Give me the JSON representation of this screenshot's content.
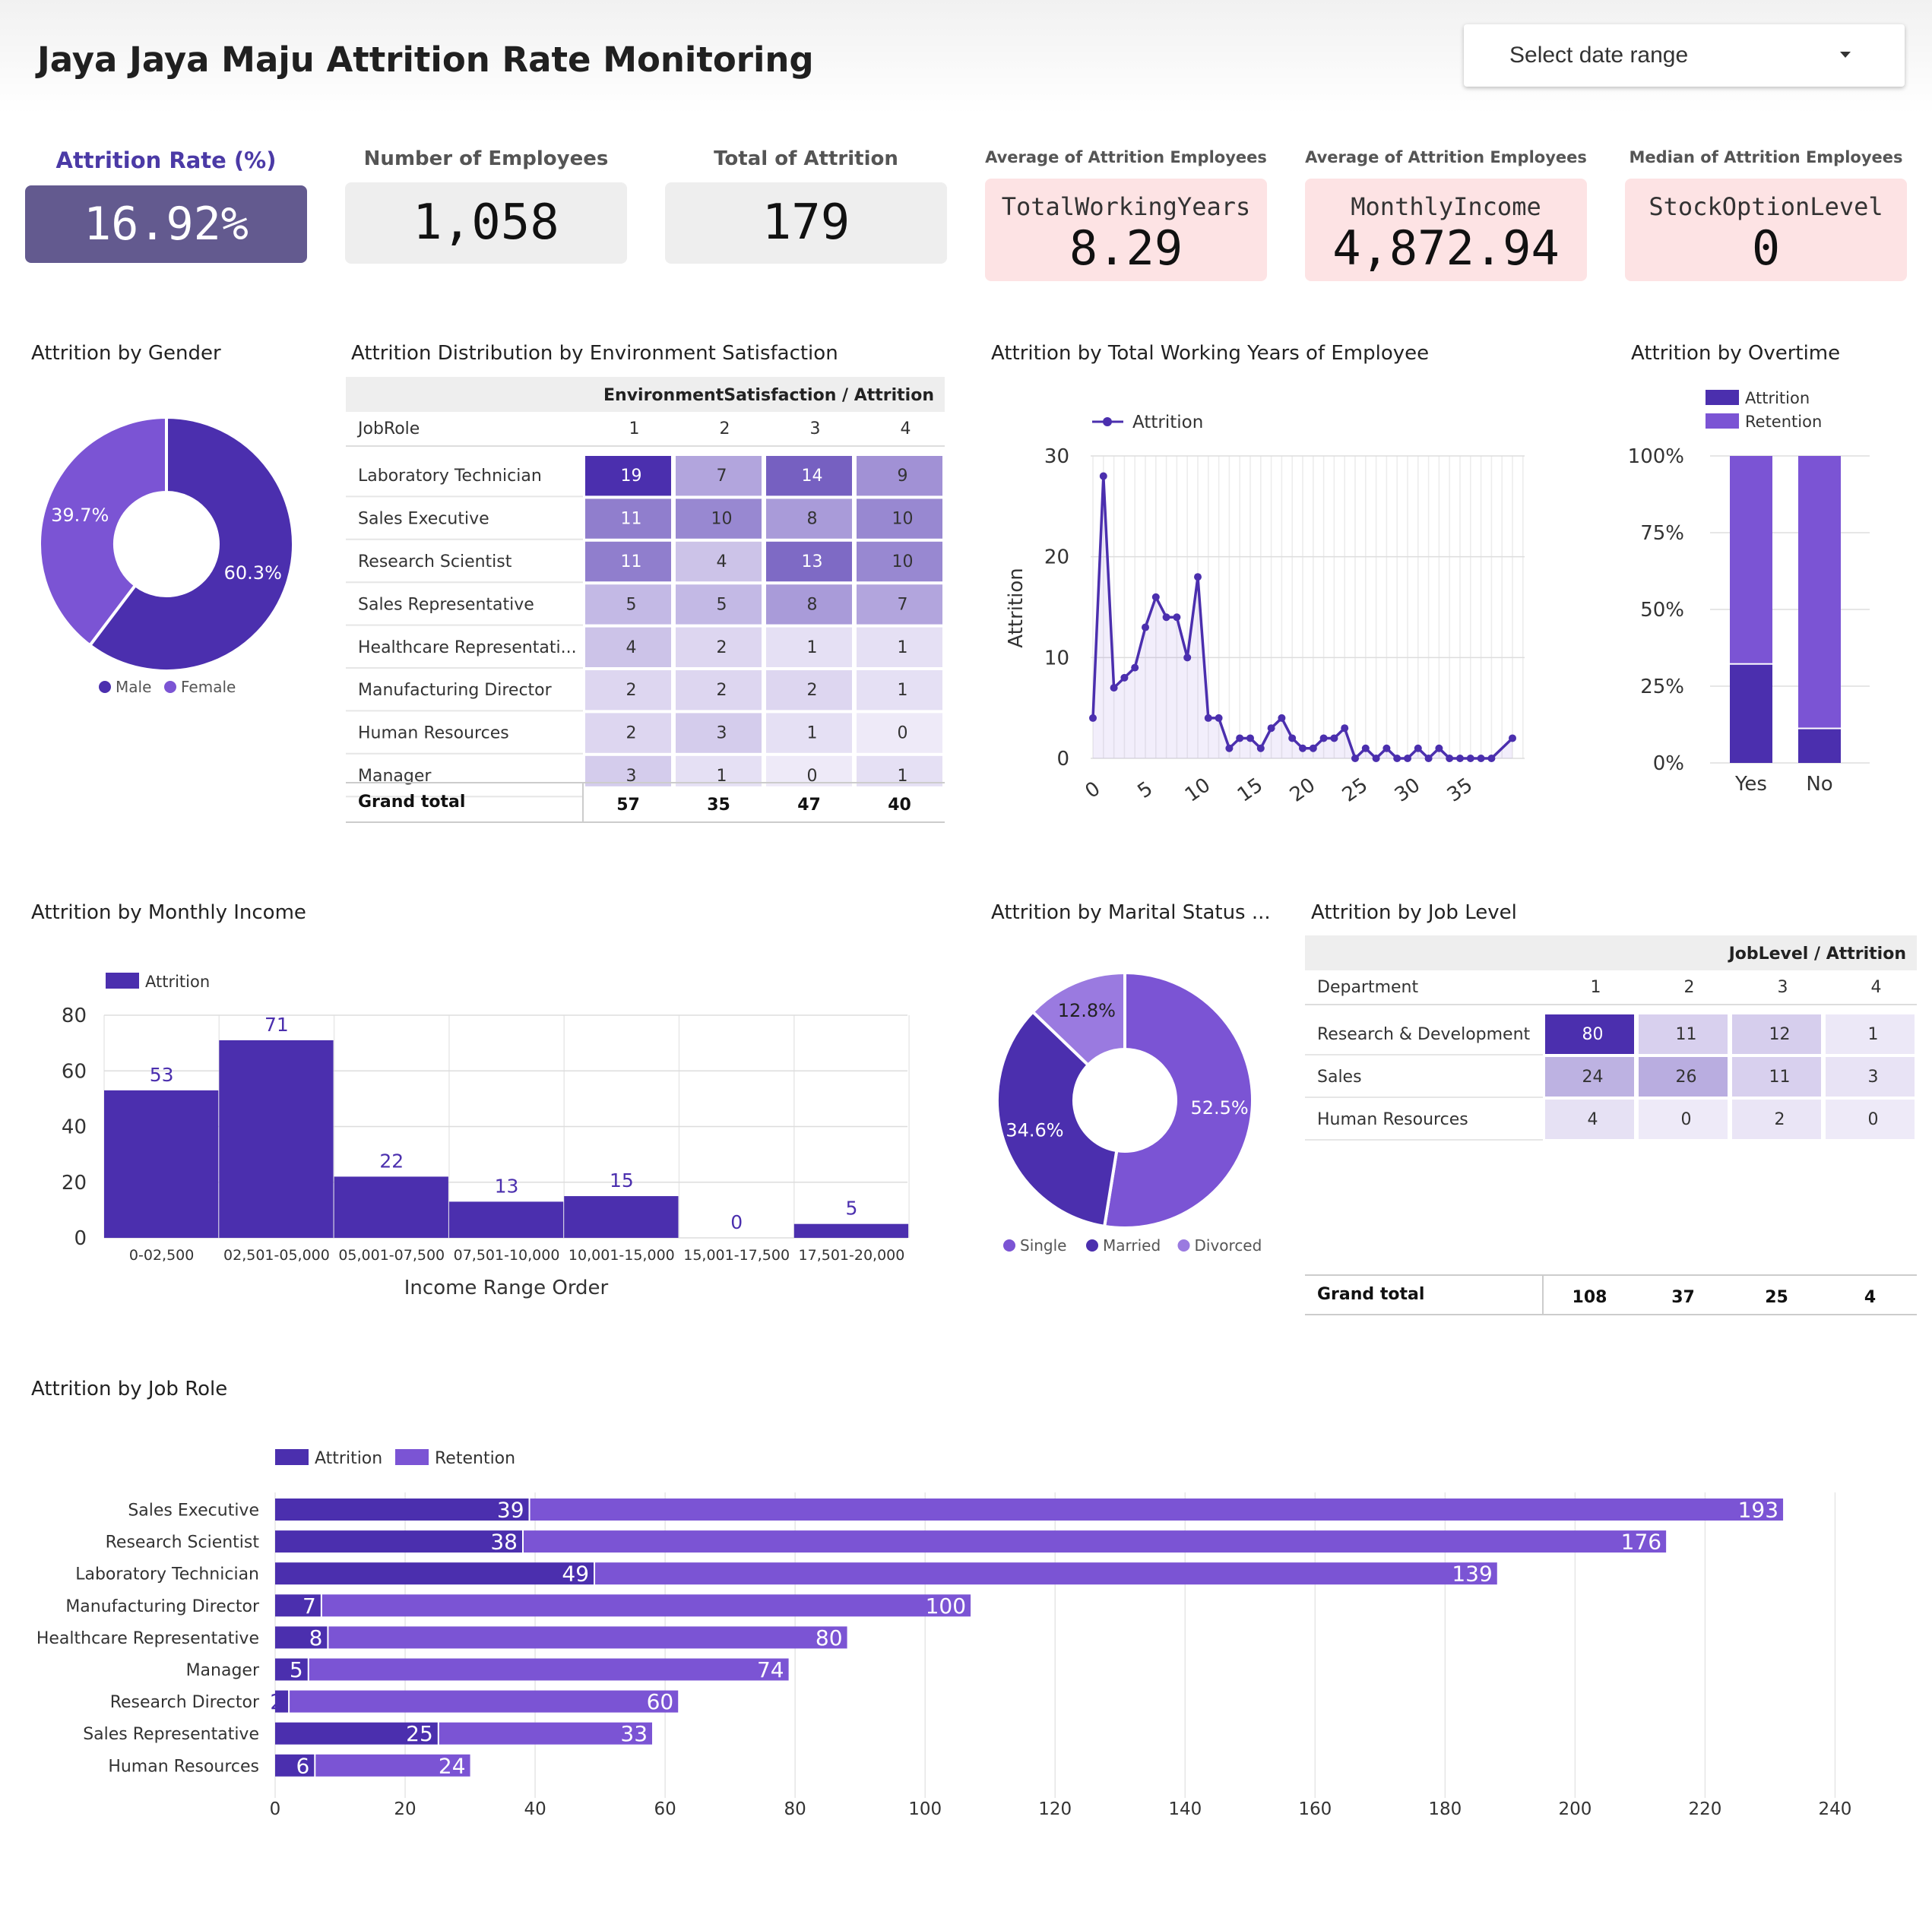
{
  "header": {
    "title": "Jaya Jaya Maju Attrition Rate Monitoring",
    "date_range_label": "Select date range"
  },
  "kpis": [
    {
      "label": "Attrition Rate (%)",
      "value": "16.92%"
    },
    {
      "label": "Number of Employees",
      "value": "1,058"
    },
    {
      "label": "Total of Attrition",
      "value": "179"
    },
    {
      "label": "Average of Attrition Employees",
      "metric": "TotalWorkingYears",
      "value": "8.29"
    },
    {
      "label": "Average of Attrition Employees",
      "metric": "MonthlyIncome",
      "value": "4,872.94"
    },
    {
      "label": "Median of Attrition Employees",
      "metric": "StockOptionLevel",
      "value": "0"
    }
  ],
  "colors": {
    "dark_purple": "#4b2fae",
    "mid_purple": "#7b54d4",
    "light_purple": "#9a7ae0",
    "kpi_primary": "#635a8f",
    "kpi_grey": "#eeeeee",
    "kpi_pink": "#fde3e4"
  },
  "sections": {
    "gender": "Attrition by Gender",
    "env": "Attrition Distribution by Environment Satisfaction",
    "years": "Attrition by Total Working Years of Employee",
    "overtime": "Attrition by Overtime",
    "income": "Attrition by Monthly Income",
    "marital": "Attrition by Marital Status ...",
    "joblevel": "Attrition by Job Level",
    "jobrole": "Attrition by Job Role"
  },
  "chart_data": [
    {
      "id": "gender",
      "type": "pie",
      "donut": true,
      "labels": [
        "Male",
        "Female"
      ],
      "values": [
        60.3,
        39.7
      ],
      "value_labels": [
        "60.3%",
        "39.7%"
      ],
      "legend": "bottom"
    },
    {
      "id": "env",
      "type": "table",
      "pivot_header": "EnvironmentSatisfaction / Attrition",
      "row_header": "JobRole",
      "columns": [
        "1",
        "2",
        "3",
        "4"
      ],
      "rows": [
        {
          "label": "Laboratory Technician",
          "values": [
            19,
            7,
            14,
            9
          ]
        },
        {
          "label": "Sales Executive",
          "values": [
            11,
            10,
            8,
            10
          ]
        },
        {
          "label": "Research Scientist",
          "values": [
            11,
            4,
            13,
            10
          ]
        },
        {
          "label": "Sales Representative",
          "values": [
            5,
            5,
            8,
            7
          ]
        },
        {
          "label": "Healthcare Representati...",
          "values": [
            4,
            2,
            1,
            1
          ]
        },
        {
          "label": "Manufacturing Director",
          "values": [
            2,
            2,
            2,
            1
          ]
        },
        {
          "label": "Human Resources",
          "values": [
            2,
            3,
            1,
            0
          ]
        },
        {
          "label": "Manager",
          "values": [
            3,
            1,
            0,
            1
          ]
        }
      ],
      "total_label": "Grand total",
      "totals": [
        57,
        35,
        47,
        40
      ]
    },
    {
      "id": "years",
      "type": "line",
      "series_name": "Attrition",
      "xlabel": "",
      "ylabel": "Attrition",
      "x": [
        0,
        1,
        2,
        3,
        4,
        5,
        6,
        7,
        8,
        9,
        10,
        11,
        12,
        13,
        14,
        15,
        16,
        17,
        18,
        19,
        20,
        21,
        22,
        23,
        24,
        25,
        26,
        27,
        28,
        29,
        30,
        31,
        32,
        33,
        34,
        35,
        36,
        37,
        38,
        40
      ],
      "y": [
        4,
        28,
        7,
        8,
        9,
        13,
        16,
        14,
        14,
        10,
        18,
        4,
        4,
        1,
        2,
        2,
        1,
        3,
        4,
        2,
        1,
        1,
        2,
        2,
        3,
        0,
        1,
        0,
        1,
        0,
        0,
        1,
        0,
        1,
        0,
        0,
        0,
        0,
        0,
        2
      ],
      "xticks": [
        "0",
        "5",
        "10",
        "15",
        "20",
        "25",
        "30",
        "35"
      ],
      "yticks": [
        "0",
        "10",
        "20",
        "30"
      ],
      "ylim": [
        0,
        30
      ],
      "legend": "top-left",
      "grid": true
    },
    {
      "id": "overtime",
      "type": "bar",
      "stacked_percent": true,
      "categories": [
        "Yes",
        "No"
      ],
      "series": [
        {
          "name": "Attrition",
          "values": [
            32,
            11
          ]
        },
        {
          "name": "Retention",
          "values": [
            68,
            89
          ]
        }
      ],
      "yticks": [
        "0%",
        "25%",
        "50%",
        "75%",
        "100%"
      ],
      "legend": "top"
    },
    {
      "id": "income",
      "type": "bar",
      "series_name": "Attrition",
      "categories": [
        "0-02,500",
        "02,501-05,000",
        "05,001-07,500",
        "07,501-10,000",
        "10,001-15,000",
        "15,001-17,500",
        "17,501-20,000"
      ],
      "values": [
        53,
        71,
        22,
        13,
        15,
        0,
        5
      ],
      "xlabel": "Income Range Order",
      "yticks": [
        "0",
        "20",
        "40",
        "60",
        "80"
      ],
      "ylim": [
        0,
        80
      ],
      "legend": "top-left"
    },
    {
      "id": "marital",
      "type": "pie",
      "donut": true,
      "labels": [
        "Single",
        "Married",
        "Divorced"
      ],
      "values": [
        52.5,
        34.6,
        12.8
      ],
      "value_labels": [
        "52.5%",
        "34.6%",
        "12.8%"
      ],
      "legend": "bottom"
    },
    {
      "id": "joblevel",
      "type": "table",
      "pivot_header": "JobLevel / Attrition",
      "row_header": "Department",
      "columns": [
        "1",
        "2",
        "3",
        "4"
      ],
      "rows": [
        {
          "label": "Research & Development",
          "values": [
            80,
            11,
            12,
            1
          ]
        },
        {
          "label": "Sales",
          "values": [
            24,
            26,
            11,
            3
          ]
        },
        {
          "label": "Human Resources",
          "values": [
            4,
            0,
            2,
            0
          ]
        }
      ],
      "total_label": "Grand total",
      "totals": [
        108,
        37,
        25,
        4
      ]
    },
    {
      "id": "jobrole",
      "type": "bar",
      "orientation": "horizontal",
      "stacked": true,
      "categories": [
        "Sales Executive",
        "Research Scientist",
        "Laboratory Technician",
        "Manufacturing Director",
        "Healthcare Representative",
        "Manager",
        "Research Director",
        "Sales Representative",
        "Human Resources"
      ],
      "series": [
        {
          "name": "Attrition",
          "values": [
            39,
            38,
            49,
            7,
            8,
            5,
            2,
            25,
            6
          ]
        },
        {
          "name": "Retention",
          "values": [
            193,
            176,
            139,
            100,
            80,
            74,
            60,
            33,
            24
          ]
        }
      ],
      "xticks": [
        "0",
        "20",
        "40",
        "60",
        "80",
        "100",
        "120",
        "140",
        "160",
        "180",
        "200",
        "220",
        "240"
      ],
      "xlim": [
        0,
        240
      ],
      "legend": "top-left"
    }
  ]
}
